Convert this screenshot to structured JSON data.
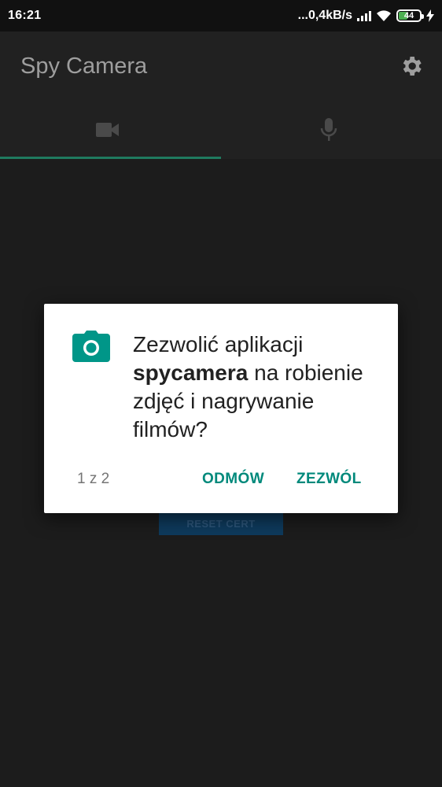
{
  "status_bar": {
    "time": "16:21",
    "network_speed": "...0,4kB/s",
    "battery_level": "44",
    "battery_fraction": 0.44,
    "icons": [
      "signal-icon",
      "wifi-icon",
      "battery-icon",
      "charging-icon"
    ]
  },
  "app_bar": {
    "title": "Spy Camera",
    "settings_icon": "gear-icon"
  },
  "tabs": [
    {
      "icon": "videocam-icon",
      "label": "",
      "selected": true
    },
    {
      "icon": "microphone-icon",
      "label": "",
      "selected": false
    }
  ],
  "content": {
    "button_label": "RESET CERT"
  },
  "dialog": {
    "icon": "camera-icon",
    "message_prefix": "Zezwolić aplikacji",
    "app_name": "spycamera",
    "message_suffix": "na robienie zdjęć i nagrywanie filmów?",
    "counter": "1 z 2",
    "deny_label": "ODMÓW",
    "allow_label": "ZEZWÓL"
  },
  "colors": {
    "accent": "#009688",
    "tab_indicator": "#1f7a5f",
    "background": "#1c1c1c",
    "app_bar": "#212121"
  }
}
